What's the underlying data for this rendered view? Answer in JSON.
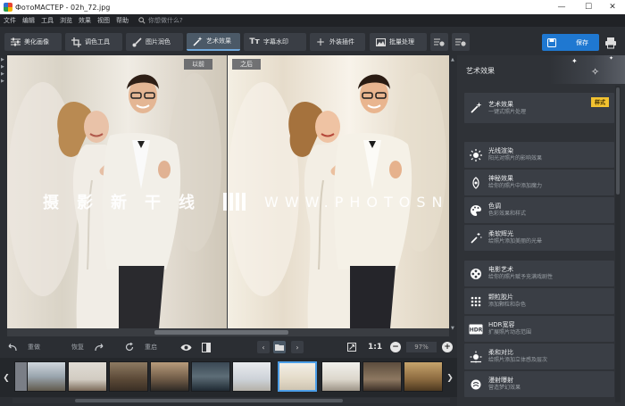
{
  "window": {
    "title": "ФотоМАСТЕР - 02h_72.jpg",
    "minimize": "—",
    "maximize": "☐",
    "close": "✕"
  },
  "menu": {
    "items": [
      "文件",
      "编辑",
      "工具",
      "浏览",
      "效果",
      "视图",
      "帮助"
    ],
    "search_placeholder": "你想做什么?"
  },
  "toolbar": {
    "tools": [
      {
        "label": "美化画像",
        "icon": "sliders-icon"
      },
      {
        "label": "调色工具",
        "icon": "crop-icon"
      },
      {
        "label": "图片润色",
        "icon": "brush-icon"
      },
      {
        "label": "艺术效果",
        "icon": "magic-wand-icon",
        "active": true
      },
      {
        "label": "字幕水印",
        "icon": "text-icon"
      },
      {
        "label": "外装插件",
        "icon": "plus-icon"
      },
      {
        "label": "批量处理",
        "icon": "image-stack-icon"
      }
    ],
    "save_label": "保存"
  },
  "viewer": {
    "before_label": "以前",
    "after_label": "之后"
  },
  "watermark": {
    "cn": "摄影新干线",
    "en": "WWW.PHOTOSNS.VIP"
  },
  "controls": {
    "undo": "重做",
    "redo": "恢复",
    "reset": "重启",
    "ratio": "1:1",
    "zoom": "97%"
  },
  "panel": {
    "title": "艺术效果",
    "effects": [
      {
        "title": "艺术效果",
        "desc": "一键式照片处理",
        "tag": "样式",
        "icon": "wand-icon"
      },
      {
        "title": "光线渲染",
        "desc": "阳光对照片的影响效果",
        "icon": "sun-icon"
      },
      {
        "title": "神秘效果",
        "desc": "给你的照片中添加魔力",
        "icon": "mystic-icon"
      },
      {
        "title": "色调",
        "desc": "色彩效果和样式",
        "icon": "palette-icon"
      },
      {
        "title": "柔软辉光",
        "desc": "给照片添加美丽的光晕",
        "icon": "glow-wand-icon"
      },
      {
        "title": "电影艺术",
        "desc": "给你的照片赋予充满戏剧性",
        "icon": "film-reel-icon"
      },
      {
        "title": "颗粒胶片",
        "desc": "添加颗粒和杂色",
        "icon": "grain-icon"
      },
      {
        "title": "HDR宽容",
        "desc": "扩展照片动态范围",
        "icon": "hdr-icon"
      },
      {
        "title": "柔和对比",
        "desc": "给照片添加立体感及层次",
        "icon": "contrast-icon"
      },
      {
        "title": "漫射曝射",
        "desc": "营造梦幻效果",
        "icon": "diffuse-icon"
      }
    ]
  },
  "colors": {
    "accent": "#1f78d1",
    "active_tool": "#4b5967",
    "panel_bg": "#2f3237",
    "tag": "#f2c230"
  }
}
